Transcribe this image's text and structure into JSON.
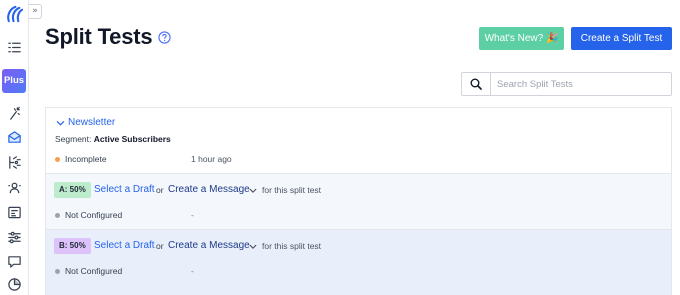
{
  "sidebar": {
    "collapse_glyph": "»",
    "plus_label": "Plus",
    "icons": [
      "list-icon",
      "magic-wand-icon",
      "envelope-icon",
      "split-icon",
      "contacts-icon",
      "form-icon",
      "sliders-icon",
      "chat-icon",
      "chart-pie-icon"
    ]
  },
  "header": {
    "title": "Split Tests",
    "whats_new_label": "What's New? 🎉",
    "create_label": "Create a Split Test"
  },
  "search": {
    "placeholder": "Search Split Tests"
  },
  "test": {
    "name": "Newsletter",
    "segment_prefix": "Segment:",
    "segment_value": "Active Subscribers",
    "status": "Incomplete",
    "status_color": "#f59e4b",
    "time": "1 hour ago",
    "variants": [
      {
        "badge": "A: 50%",
        "select_label": "Select a Draft",
        "or_label": "or",
        "create_label": "Create a Message",
        "suffix": "for this split test",
        "status": "Not Configured",
        "dash": "-"
      },
      {
        "badge": "B: 50%",
        "select_label": "Select a Draft",
        "or_label": "or",
        "create_label": "Create a Message",
        "suffix": "for this split test",
        "status": "Not Configured",
        "dash": "-"
      }
    ]
  },
  "colors": {
    "accent": "#2563eb",
    "whats_new": "#5ccfa5",
    "badge_a": "#bdeccd",
    "badge_b": "#dec2fa",
    "not_configured_dot": "#9ca3af"
  }
}
